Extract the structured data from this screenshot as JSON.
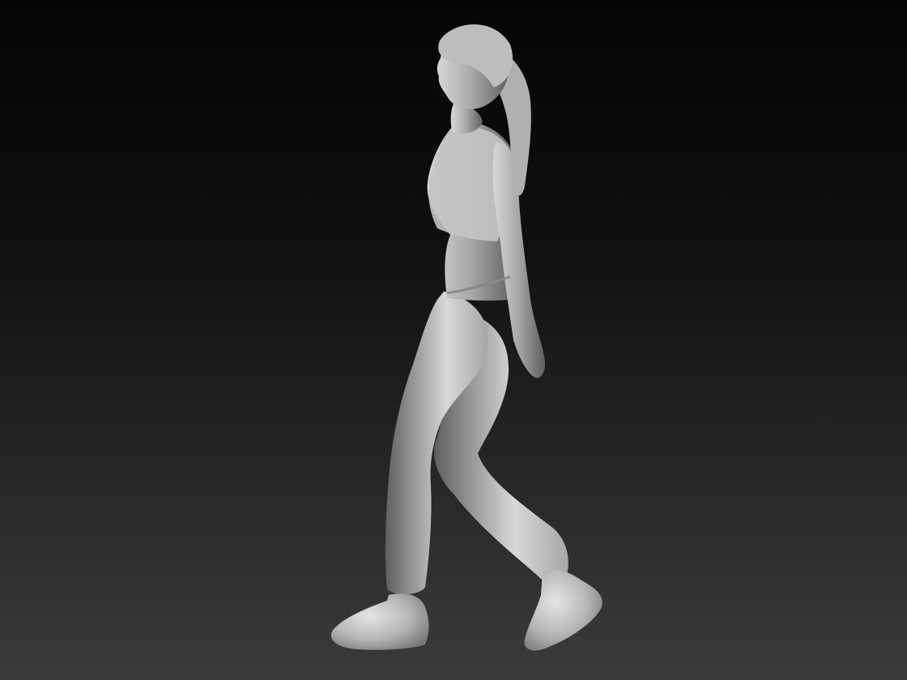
{
  "scene": {
    "background_top": "#050505",
    "background_bottom": "#3b3b3b",
    "material_light": "#d8d8d8",
    "material_mid": "#a6a6a6",
    "material_dark": "#5e5e5e",
    "subject": "figure-walking-sculpt"
  }
}
